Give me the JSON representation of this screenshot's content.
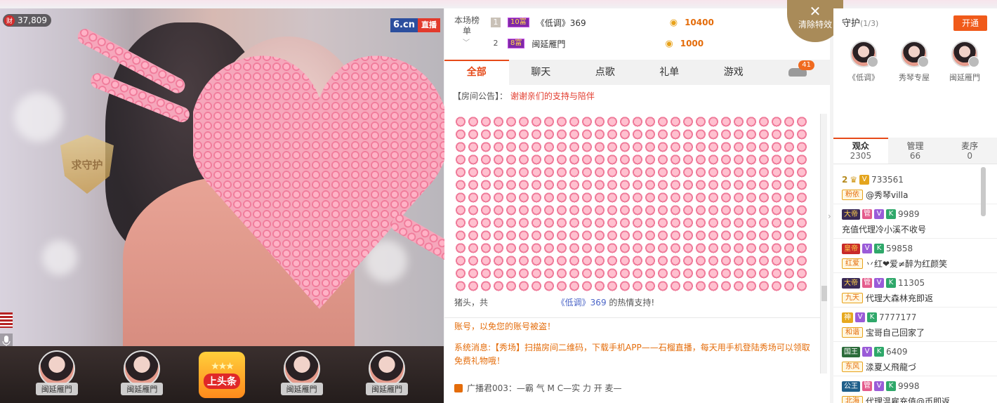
{
  "video": {
    "wealth_count": "37,809",
    "wealth_icon_label": "财",
    "brand_logo": "6.cn",
    "live_label": "直播",
    "guard_badge": "求守护"
  },
  "giftbar": {
    "fans": [
      "闽延雁門",
      "闽延雁門",
      "闽延雁門",
      "闽延雁門"
    ],
    "headline_label": "上头条"
  },
  "ranking": {
    "label": "本场榜单",
    "rows": [
      {
        "rank": "1",
        "level": "10富",
        "name": "《低调》369",
        "amount": "10400"
      },
      {
        "rank": "2",
        "level": "8富",
        "name": "闽延雁門",
        "amount": "1000"
      }
    ]
  },
  "clear_effects": {
    "label": "清除特效"
  },
  "chat_tabs": {
    "items": [
      "全部",
      "聊天",
      "点歌",
      "礼单",
      "游戏"
    ],
    "active_index": 0,
    "car_badge": "41"
  },
  "notice": {
    "prefix": "【房间公告】：",
    "text": "谢谢亲们的支持与陪伴"
  },
  "chat": {
    "gift_line_a": "猪头，共",
    "gift_line_user": "《低调》369",
    "gift_line_b": "的热情支持!",
    "warning": "账号，以免您的账号被盗！",
    "system_msg": "系统消息:【秀场】扫描房间二维码，下载手机APP——石榴直播，每天用手机登陆秀场可以领取免费礼物哦！",
    "broadcast": "广播君003：—霸 气 M C—实 力 开 麦—"
  },
  "guard": {
    "title": "守护",
    "count": "(1/3)",
    "open_button": "开通",
    "members": [
      "《低调》",
      "秀琴专屋",
      "闽延雁門"
    ]
  },
  "audience_tabs": [
    {
      "label": "观众",
      "count": "2305"
    },
    {
      "label": "管理",
      "count": "66"
    },
    {
      "label": "麦序",
      "count": "0"
    }
  ],
  "audience": [
    {
      "rank": "2",
      "tags": [
        {
          "t": "V",
          "c": "s-v"
        }
      ],
      "id": "733561",
      "fan": "粉依",
      "name": "@秀琴villa"
    },
    {
      "rank": "",
      "tags": [
        {
          "t": "大帝",
          "c": "t-dark"
        },
        {
          "t": "管",
          "c": "s-pink"
        },
        {
          "t": "V",
          "c": "s-purple"
        },
        {
          "t": "K",
          "c": "s-green"
        }
      ],
      "id": "9989",
      "fan": "",
      "name": "充值代理冷小溪不收号"
    },
    {
      "rank": "",
      "tags": [
        {
          "t": "皇帝",
          "c": "t-red"
        },
        {
          "t": "V",
          "c": "s-purple"
        },
        {
          "t": "K",
          "c": "s-green"
        }
      ],
      "id": "59858",
      "fan": "红爱",
      "name": "丷红❤爱≠醉为红颜笑"
    },
    {
      "rank": "",
      "tags": [
        {
          "t": "大帝",
          "c": "t-dark"
        },
        {
          "t": "管",
          "c": "s-pink"
        },
        {
          "t": "V",
          "c": "s-purple"
        },
        {
          "t": "K",
          "c": "s-green"
        }
      ],
      "id": "11305",
      "fan": "九天",
      "name": "代理大森林充即返"
    },
    {
      "rank": "",
      "tags": [
        {
          "t": "神",
          "c": "t-gold"
        },
        {
          "t": "V",
          "c": "s-purple"
        },
        {
          "t": "K",
          "c": "s-green"
        }
      ],
      "id": "7777177",
      "fan": "和谐",
      "name": "宝哥自己回家了"
    },
    {
      "rank": "",
      "tags": [
        {
          "t": "国王",
          "c": "t-green"
        },
        {
          "t": "V",
          "c": "s-purple"
        },
        {
          "t": "K",
          "c": "s-green"
        }
      ],
      "id": "6409",
      "fan": "东风",
      "name": "渁夏乂飛龍づ"
    },
    {
      "rank": "",
      "tags": [
        {
          "t": "公王",
          "c": "t-sea"
        },
        {
          "t": "管",
          "c": "s-pink"
        },
        {
          "t": "V",
          "c": "s-purple"
        },
        {
          "t": "K",
          "c": "s-green"
        }
      ],
      "id": "9998",
      "fan": "北海",
      "name": "代理温雇充值@币即返"
    }
  ]
}
